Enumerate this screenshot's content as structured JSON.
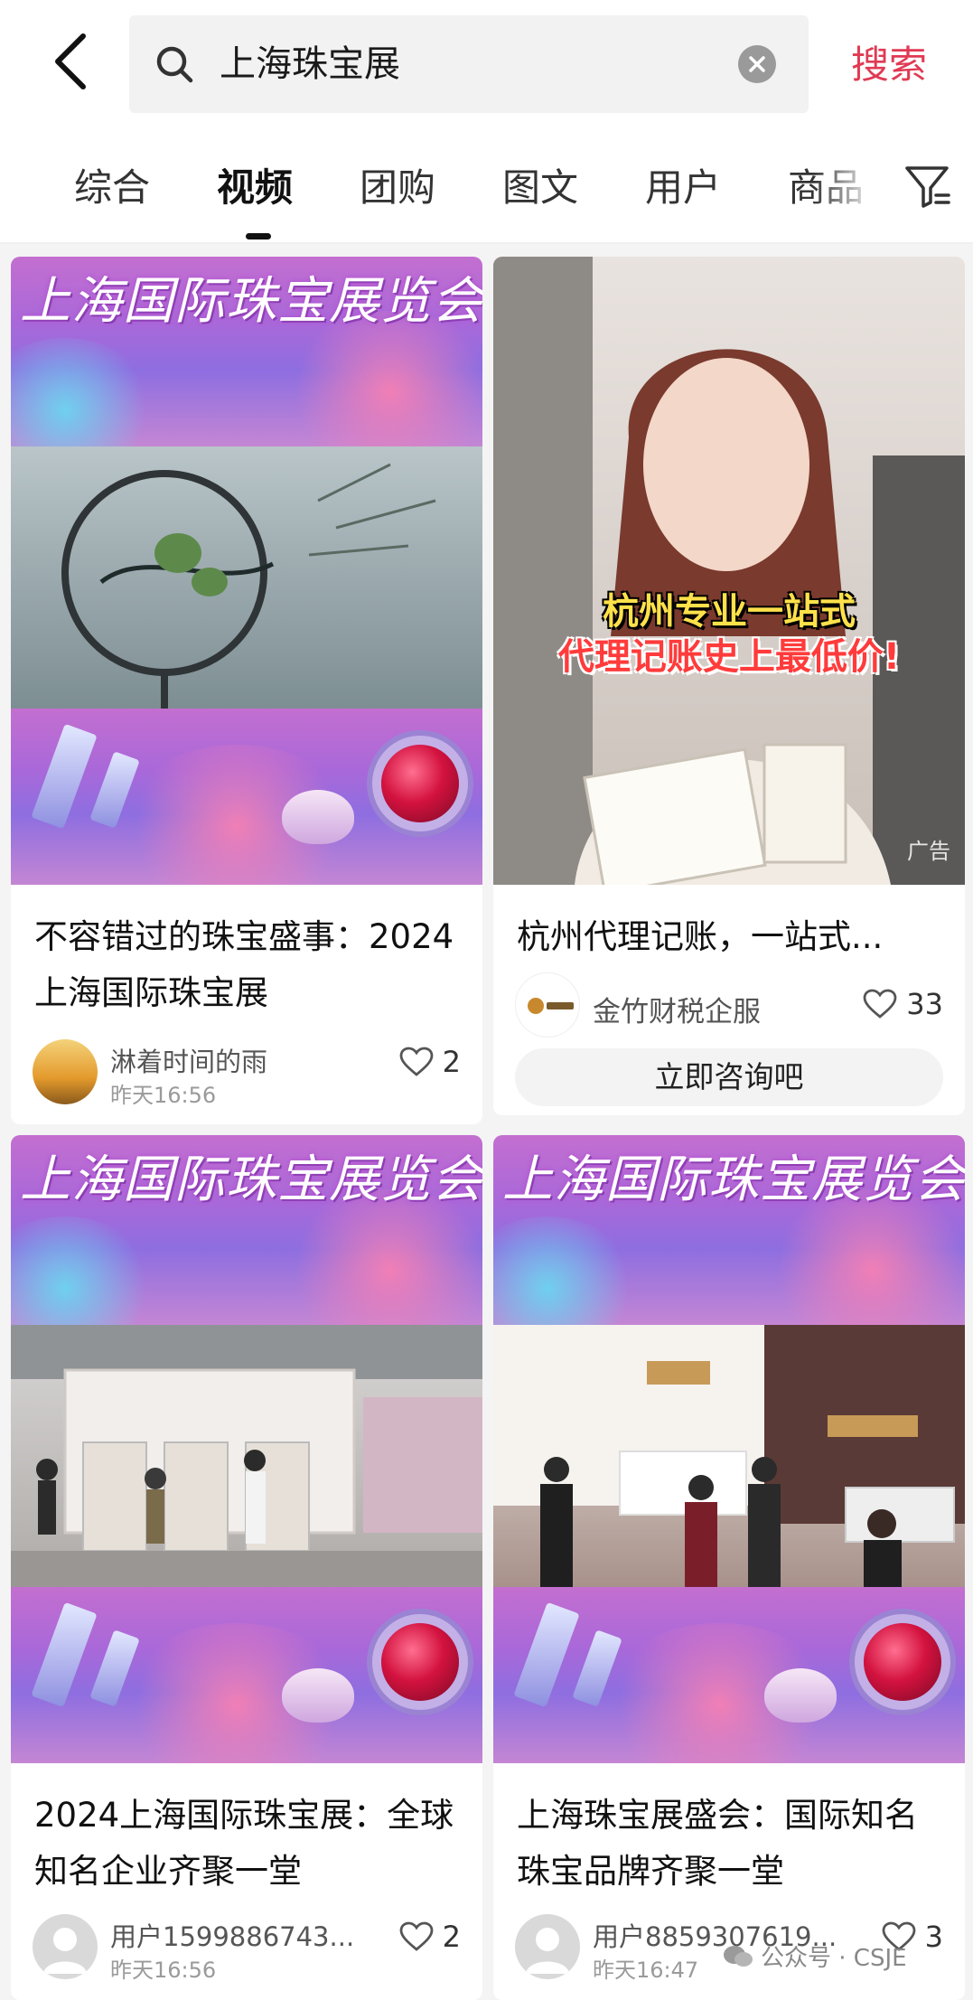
{
  "search": {
    "query": "上海珠宝展",
    "button_label": "搜索"
  },
  "tabs": [
    {
      "label": "综合"
    },
    {
      "label": "视频"
    },
    {
      "label": "团购"
    },
    {
      "label": "图文"
    },
    {
      "label": "用户"
    },
    {
      "label": "商品"
    }
  ],
  "active_tab": "视频",
  "colors": {
    "accent": "#e03a54",
    "indicator": "#111111"
  },
  "cards": [
    {
      "banner_title": "上海国际珠宝展览会",
      "caption": "不容错过的珠宝盛事：2024上海国际珠宝展",
      "author": "淋着时间的雨",
      "time": "昨天16:56",
      "likes": "2"
    },
    {
      "overlay_line1": "杭州专业一站式",
      "overlay_line2": "代理记账史上最低价!",
      "badge": "广告",
      "caption": "杭州代理记账，一站式...",
      "author": "金竹财税企服",
      "likes": "33",
      "cta": "立即咨询吧"
    },
    {
      "banner_title": "上海国际珠宝展览会",
      "caption": "2024上海国际珠宝展：全球知名企业齐聚一堂",
      "author": "用户1599886743...",
      "time": "昨天16:56",
      "likes": "2"
    },
    {
      "banner_title": "上海国际珠宝展览会",
      "caption": "上海珠宝展盛会：国际知名珠宝品牌齐聚一堂",
      "author": "用户8859307619...",
      "time": "昨天16:47",
      "likes": "3"
    }
  ],
  "watermark": "公众号 · CSJE"
}
